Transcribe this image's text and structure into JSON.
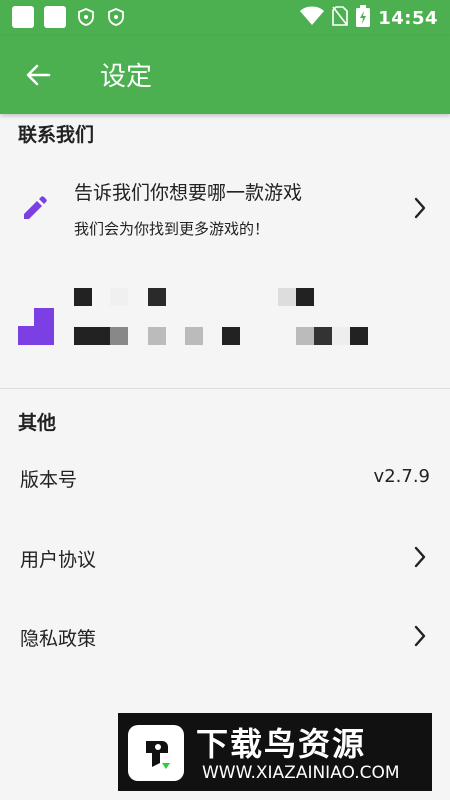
{
  "status_bar": {
    "time": "14:54"
  },
  "app_bar": {
    "title": "设定"
  },
  "contact_section": {
    "title": "联系我们",
    "request_game": {
      "title": "告诉我们你想要哪一款游戏",
      "subtitle": "我们会为你找到更多游戏的！"
    }
  },
  "other_section": {
    "title": "其他",
    "version": {
      "label": "版本号",
      "value": "v2.7.9"
    },
    "user_agreement": {
      "label": "用户协议"
    },
    "privacy_policy": {
      "label": "隐私政策"
    }
  },
  "watermark": {
    "title": "下载鸟资源",
    "url": "WWW.XIAZAINIAO.COM"
  },
  "colors": {
    "primary": "#4caf50",
    "accent": "#7b3fe4"
  },
  "icons": [
    "back-arrow-icon",
    "pencil-icon",
    "chevron-right-icon",
    "wifi-icon",
    "no-sim-icon",
    "battery-charging-icon",
    "shield-icon"
  ]
}
